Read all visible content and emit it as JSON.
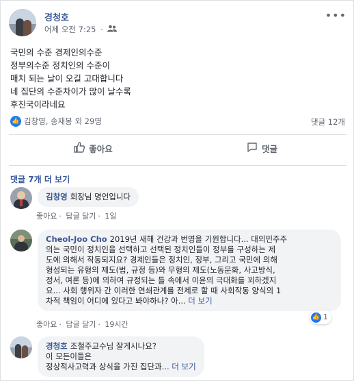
{
  "post": {
    "author": "경청호",
    "time": "어제 오전 7:25",
    "privacy_icon": "friends-icon",
    "lines": [
      "국민의 수준 경제인의수준",
      "정부의수준 정치인의 수준이",
      "매치 되는 날이 오길 고대합니다",
      "네 집단의 수준차이가 많이 날수록",
      "후진국이라네요"
    ],
    "reactions": "김창영, 송재봉 외 29명",
    "comment_count": "댓글 12개"
  },
  "actions": {
    "like": "좋아요",
    "comment": "댓글"
  },
  "comments_section": {
    "previous": "댓글 7개 더 보기",
    "items": [
      {
        "name": "김창영",
        "lines": [
          "회장님 명언입니다"
        ],
        "like": "좋아요",
        "reply": "답글 달기",
        "time": "1일"
      },
      {
        "name": "Cheol-Joo Cho",
        "lines": [
          "2019년 새해 건강과 번영을 기원합니다... 대의민주주",
          "의는 국민이 정치인을 선택하고 선택된 정치인들이 정부를 구성하는 제",
          "도에 의해서 작동되지요? 경제인들은 정치인, 정부, 그리고 국민에 의해",
          "형성되는 유형의 제도(법, 규정 등)와 무형의 제도(노동문화, 사고방식,",
          "정서, 여론 등)에 의하여 규정되는 틀 속에서 이윤의 극대화를 꾀하겠지",
          "요... 사회 행위자 간 이러한 연쇄관계를 전제로 할 때 사회작동 양식의 1",
          "차적 책임이 어디에 있다고 봐야하나? 아..."
        ],
        "more": "더 보기",
        "like": "좋아요",
        "reply": "답글 달기",
        "time": "19시간",
        "reaction_count": "1"
      },
      {
        "name": "경청호",
        "lines": [
          "조철주교수님 잘게시나요?",
          "이 모든이들은",
          "정상적사고력과 상식을 가진 집단과..."
        ],
        "more": "더 보기"
      }
    ]
  },
  "colors": {
    "link": "#385898",
    "like_blue": "#2078f4",
    "muted": "#606770",
    "bubble": "#f2f3f5"
  }
}
